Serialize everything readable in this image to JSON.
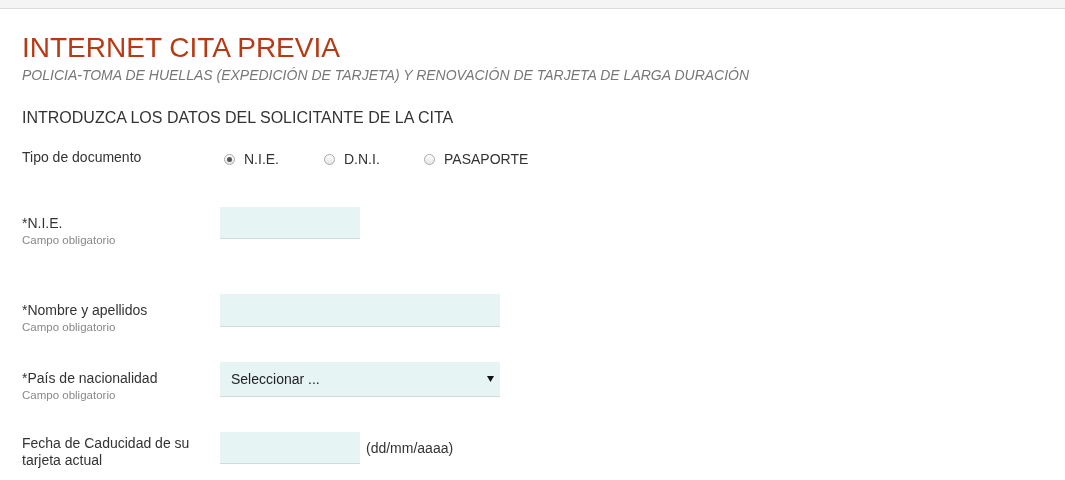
{
  "header": {
    "title": "INTERNET CITA PREVIA",
    "subtitle": "POLICIA-TOMA DE HUELLAS (EXPEDICIÓN DE TARJETA) Y RENOVACIÓN DE TARJETA DE LARGA DURACIÓN"
  },
  "section_title": "INTRODUZCA LOS DATOS DEL SOLICITANTE DE LA CITA",
  "document_type": {
    "label": "Tipo de documento",
    "options": [
      {
        "label": "N.I.E.",
        "selected": true
      },
      {
        "label": "D.N.I.",
        "selected": false
      },
      {
        "label": "PASAPORTE",
        "selected": false
      }
    ]
  },
  "fields": [
    {
      "kind": "text",
      "wide": false,
      "label": "*N.I.E.",
      "note": "Campo obligatorio"
    },
    {
      "kind": "text",
      "wide": true,
      "label": "*Nombre y apellidos",
      "note": "Campo obligatorio"
    },
    {
      "kind": "select",
      "wide": true,
      "label": "*País de nacionalidad",
      "note": "Campo obligatorio",
      "value": "Seleccionar ..."
    },
    {
      "kind": "text",
      "wide": false,
      "label": "Fecha de Caducidad de su tarjeta actual",
      "suffix": "(dd/mm/aaaa)"
    }
  ]
}
